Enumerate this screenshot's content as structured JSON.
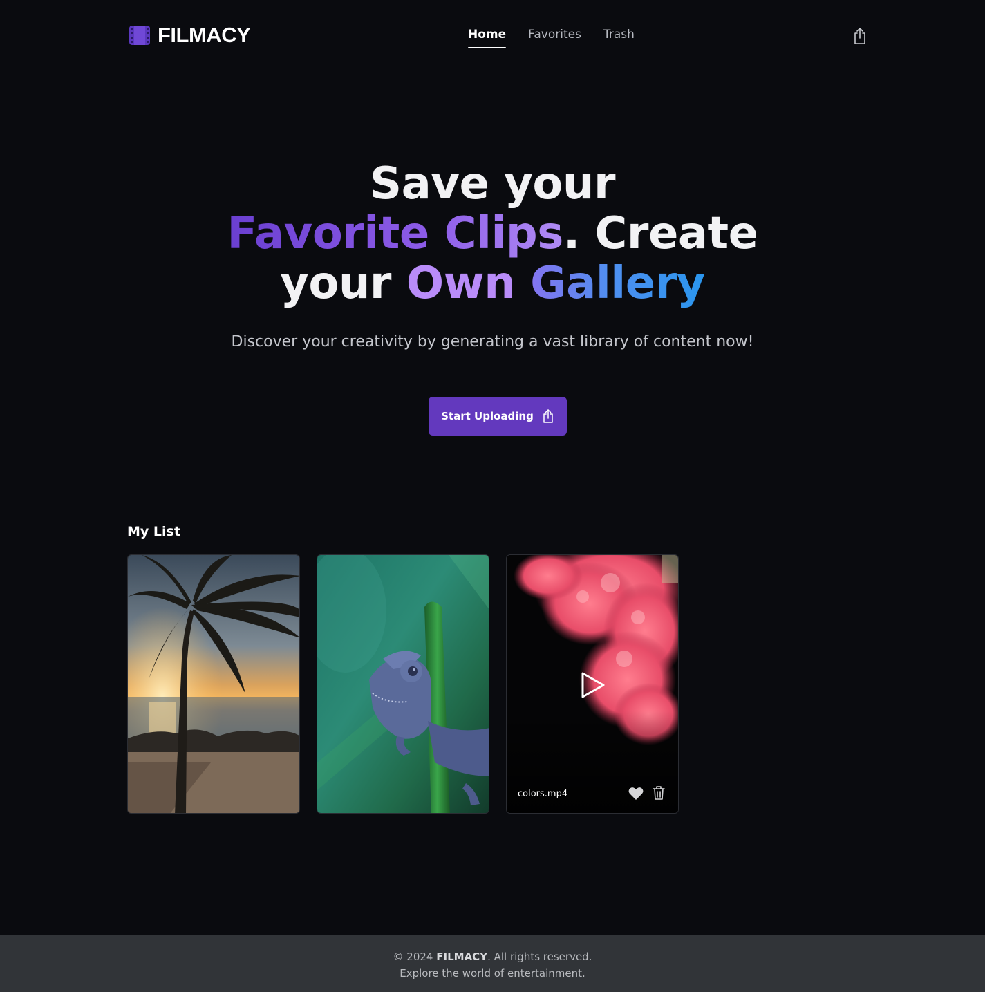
{
  "header": {
    "brand": "FILMACY",
    "nav": [
      {
        "label": "Home",
        "active": true
      },
      {
        "label": "Favorites",
        "active": false
      },
      {
        "label": "Trash",
        "active": false
      }
    ],
    "logo_icon": "film-icon",
    "upload_icon": "share-upload-icon"
  },
  "hero": {
    "line1": "Save your",
    "line2_part1": "Favorite Clips",
    "line2_part2": ". Create",
    "line3_part1": "your ",
    "line3_part2": "Own",
    "line3_part3": " Gallery",
    "subtitle": "Discover your creativity by generating a vast library of content now!",
    "cta_label": "Start Uploading"
  },
  "my_list": {
    "title": "My List",
    "items": [
      {
        "thumbnail": "palm-tree-sunset"
      },
      {
        "thumbnail": "chameleon"
      },
      {
        "thumbnail": "pink-smoke",
        "filename": "colors.mp4"
      }
    ]
  },
  "footer": {
    "copyright": "© 2024",
    "brand": "FILMACY",
    "rights": ". All rights reserved.",
    "tagline": "Explore the world of entertainment."
  },
  "colors": {
    "background": "#0a0b0f",
    "accent": "#6339be",
    "footer_bg": "#313438"
  }
}
